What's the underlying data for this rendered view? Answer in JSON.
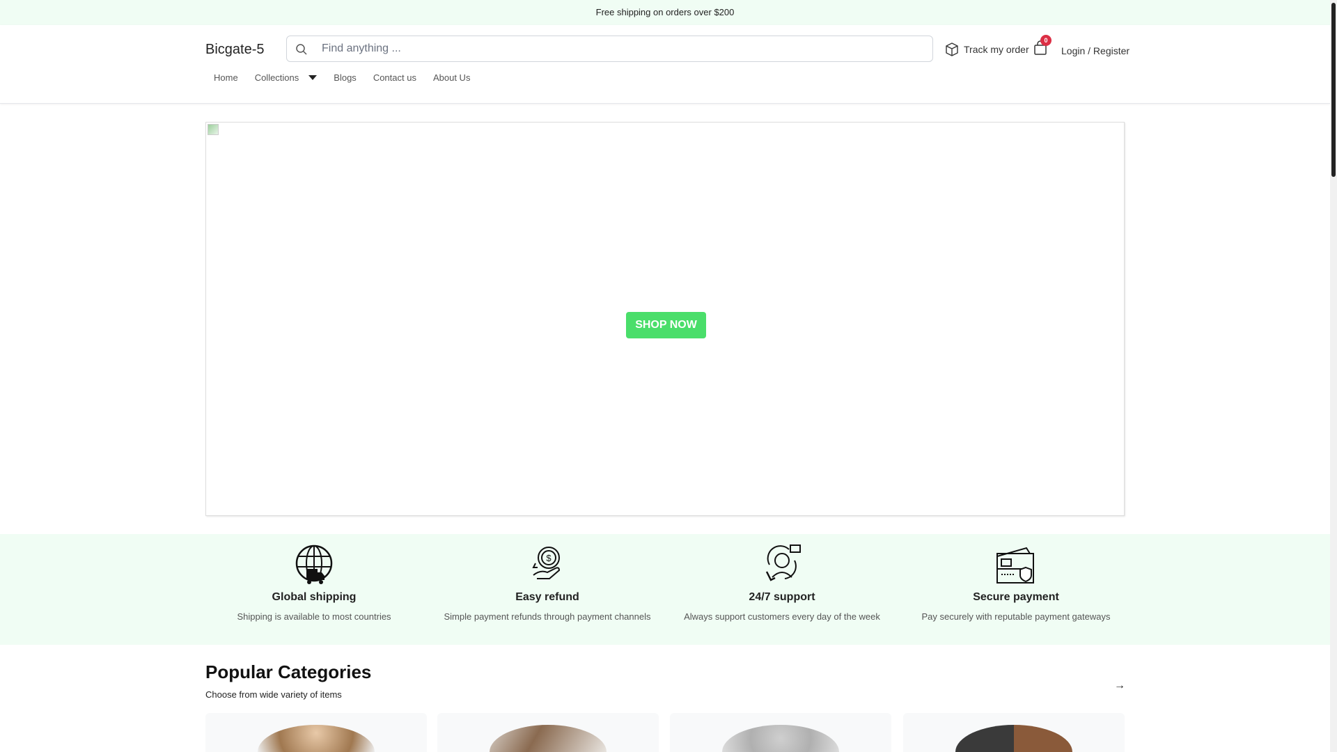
{
  "topbar": {
    "text": "Free shipping on orders over $200"
  },
  "header": {
    "logo": "Bicgate-5",
    "search_placeholder": "Find anything ...",
    "track_label": "Track my order",
    "cart_count": "0",
    "login_label": "Login / Register"
  },
  "nav": {
    "items": [
      "Home",
      "Collections",
      "Blogs",
      "Contact us",
      "About Us"
    ]
  },
  "hero": {
    "button": "SHOP NOW"
  },
  "features": [
    {
      "icon": "globe-truck-icon",
      "title": "Global shipping",
      "desc": "Shipping is available to most countries"
    },
    {
      "icon": "hand-coin-icon",
      "title": "Easy refund",
      "desc": "Simple payment refunds through payment channels"
    },
    {
      "icon": "support-agent-icon",
      "title": "24/7 support",
      "desc": "Always support customers every day of the week"
    },
    {
      "icon": "card-shield-icon",
      "title": "Secure payment",
      "desc": "Pay securely with reputable payment gateways"
    }
  ],
  "categories": {
    "title": "Popular Categories",
    "subtitle": "Choose from wide variety of items"
  },
  "colors": {
    "accent": "#4ade6a",
    "band": "#f0fdf4",
    "badge": "#dc2f45"
  }
}
